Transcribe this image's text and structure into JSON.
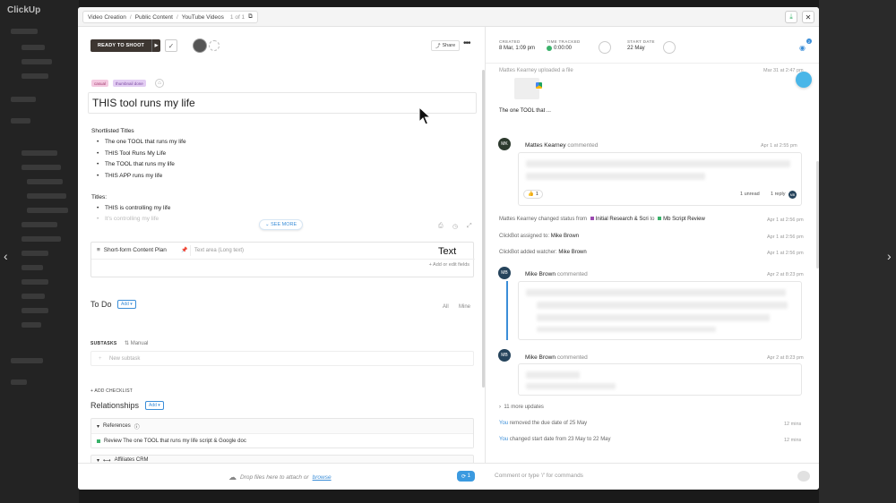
{
  "background_app": {
    "logo": "ClickUp"
  },
  "modal": {
    "breadcrumbs": [
      "Video Creation",
      "Public Content",
      "YouTube Videos"
    ],
    "position": "1 of 1",
    "status_label": "READY TO SHOOT",
    "share_label": "Share",
    "tags": [
      "casual",
      "thumbnail done"
    ],
    "task_title": "THIS tool runs my life",
    "description": {
      "heading1": "Shortlisted Titles",
      "list1": [
        "The one TOOL that runs my life",
        "THIS Tool Runs My Life",
        "The TOOL that runs my life",
        "THIS APP runs my life"
      ],
      "heading2": "Titles:",
      "list2": [
        "THIS is controlling my life",
        "It's controlling my life"
      ],
      "see_more": "SEE MORE"
    },
    "custom_field": {
      "label": "Short-form Content Plan",
      "placeholder": "Text area (Long text)",
      "edit_link": "+ Add or edit fields",
      "overlay_text": "Text"
    },
    "todo": {
      "heading": "To Do",
      "add_label": "Add",
      "filter_all": "All",
      "filter_mine": "Mine",
      "subtasks_label": "SUBTASKS",
      "manual_label": "Manual",
      "new_subtask": "New subtask",
      "add_checklist": "+ ADD CHECKLIST"
    },
    "relationships": {
      "heading": "Relationships",
      "add_label": "Add",
      "references_label": "References",
      "reference_item": "Review The one TOOL that runs my life script & Google doc",
      "affiliates_label": "Affiliates CRM"
    },
    "bottom": {
      "drop_text": "Drop files here to attach or",
      "browse": "browse",
      "attach_count": "1",
      "comment_placeholder": "Comment or type '/' for commands"
    },
    "meta": {
      "created_k": "CREATED",
      "created_v": "8 Mar, 1:09 pm",
      "time_k": "TIME TRACKED",
      "time_v": "0:00:00",
      "start_k": "START DATE",
      "start_v": "22 May",
      "watchers": "2"
    },
    "activity": {
      "upload_text": "Mattes Kearney uploaded a file",
      "upload_time": "Mar 31 at 2:47 pm",
      "upload_caption": "The one TOOL that ...",
      "c1_name": "Mattes Kearney",
      "c1_verb": "commented",
      "c1_time": "Apr 1 at 2:55 pm",
      "c1_initials": "MK",
      "c1_reaction": "1",
      "c1_unread": "1 unread",
      "c1_reply": "1 reply",
      "c1_reply_av": "MB",
      "s1_pre": "Mattes Kearney changed status from",
      "s1_from": "Initial Research & Scri",
      "s1_to_word": "to",
      "s1_to": "Mb Script Review",
      "s1_time": "Apr 1 at 2:56 pm",
      "s2_text": "ClickBot assigned to:",
      "s2_who": "Mike Brown",
      "s2_time": "Apr 1 at 2:56 pm",
      "s3_text": "ClickBot added watcher:",
      "s3_who": "Mike Brown",
      "s3_time": "Apr 1 at 2:56 pm",
      "c2_name": "Mike Brown",
      "c2_verb": "commented",
      "c2_time": "Apr 2 at 8:23 pm",
      "c2_initials": "MB",
      "c3_name": "Mike Brown",
      "c3_verb": "commented",
      "c3_time": "Apr 2 at 8:23 pm",
      "c3_initials": "MB",
      "more_updates": "11 more updates",
      "u1_you": "You",
      "u1_text": "removed the due date of 25 May",
      "u1_time": "12 mins",
      "u2_you": "You",
      "u2_text": "changed start date from 23 May to 22 May",
      "u2_time": "12 mins"
    }
  },
  "colors": {
    "accent": "#3b8ed8",
    "status_bg": "#3d3631",
    "green": "#3ab26a",
    "purple": "#9b4ab0"
  }
}
